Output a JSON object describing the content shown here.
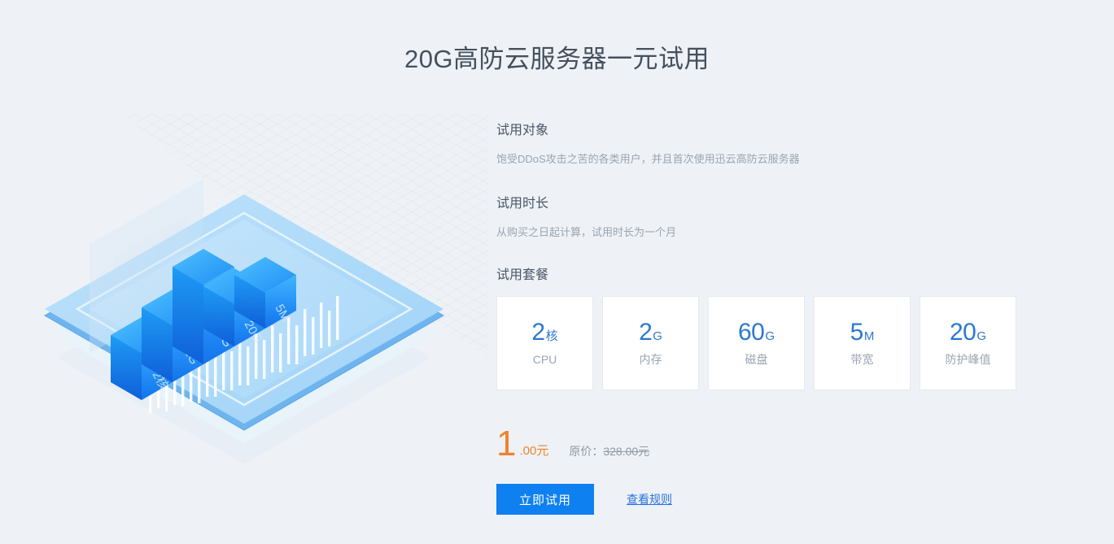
{
  "page": {
    "title": "20G高防云服务器一元试用",
    "background_color": "#eef2f6",
    "accent_blue": "#2b78d2",
    "button_blue": "#0e80f0",
    "price_orange": "#f0822c"
  },
  "sections": {
    "audience": {
      "heading": "试用对象",
      "description": "饱受DDoS攻击之苦的各类用户，并且首次使用迅云高防云服务器"
    },
    "duration": {
      "heading": "试用时长",
      "description": "从购买之日起计算，试用时长为一个月"
    },
    "package": {
      "heading": "试用套餐"
    }
  },
  "specs": [
    {
      "number": "2",
      "unit": "核",
      "label": "CPU"
    },
    {
      "number": "2",
      "unit": "G",
      "label": "内存"
    },
    {
      "number": "60",
      "unit": "G",
      "label": "磁盘"
    },
    {
      "number": "5",
      "unit": "M",
      "label": "带宽"
    },
    {
      "number": "20",
      "unit": "G",
      "label": "防护峰值"
    }
  ],
  "price": {
    "amount": "1",
    "decimals": ".00元",
    "original_prefix": "原价：",
    "original_value": "328.00元"
  },
  "actions": {
    "primary_label": "立即试用",
    "rules_link_label": "查看规则"
  },
  "illustration": {
    "name": "isometric-bar-chart-platform",
    "bars": [
      {
        "number": "2",
        "unit": "核"
      },
      {
        "number": "2",
        "unit": "G"
      },
      {
        "number": "60",
        "unit": "G"
      },
      {
        "number": "20",
        "unit": "G"
      },
      {
        "number": "5",
        "unit": "M"
      }
    ]
  },
  "chart_data": {
    "type": "bar",
    "title": "",
    "categories": [
      "CPU",
      "内存",
      "磁盘",
      "防护峰值",
      "带宽"
    ],
    "values": [
      2,
      2,
      60,
      20,
      5
    ],
    "units": [
      "核",
      "G",
      "G",
      "G",
      "M"
    ],
    "bar_labels": [
      "2核",
      "2G",
      "60G",
      "20G",
      "5M"
    ],
    "xlabel": "",
    "ylabel": "",
    "legend": "none",
    "grid": false
  }
}
